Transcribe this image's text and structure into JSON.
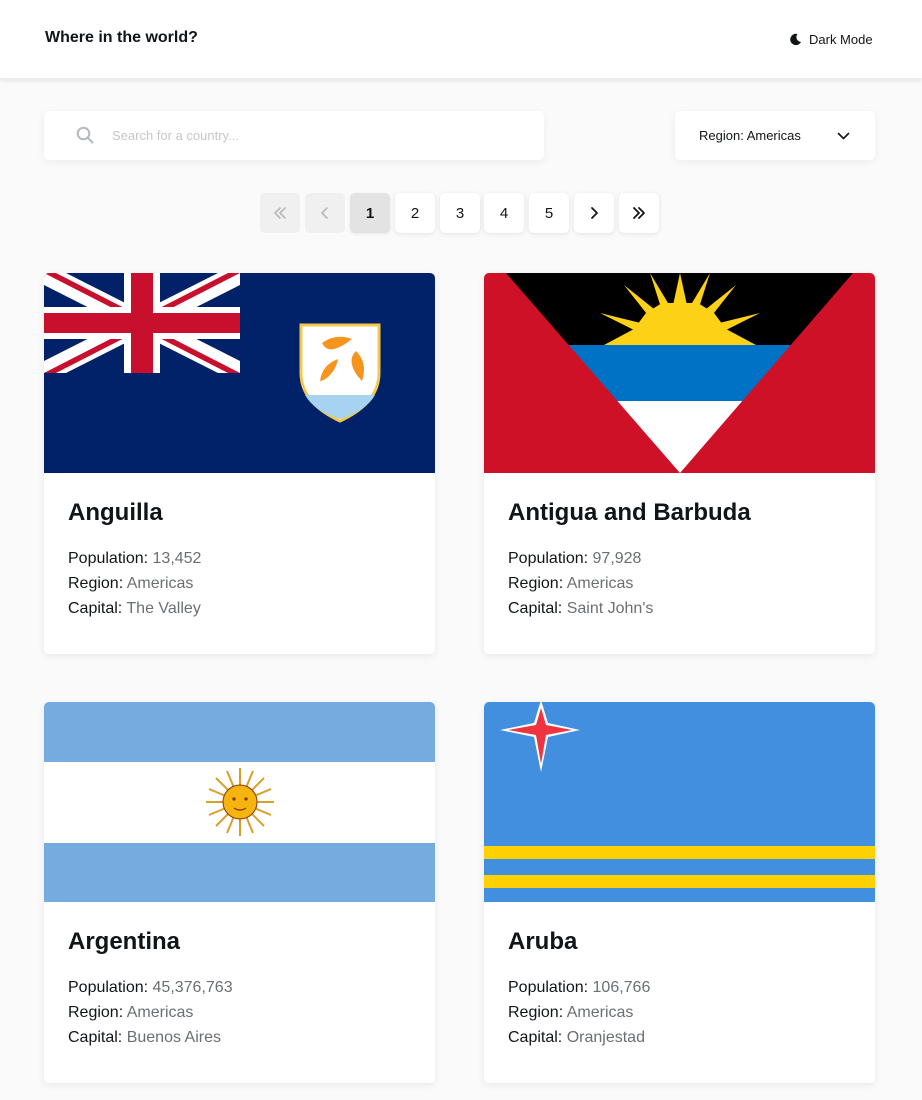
{
  "header": {
    "title": "Where in the world?",
    "dark_mode_label": "Dark Mode"
  },
  "search": {
    "placeholder": "Search for a country...",
    "value": ""
  },
  "filter": {
    "label": "Region: Americas"
  },
  "pagination": {
    "pages": [
      "1",
      "2",
      "3",
      "4",
      "5"
    ],
    "current_page": "1"
  },
  "fact_labels": {
    "population": "Population:",
    "region": "Region:",
    "capital": "Capital:"
  },
  "countries": [
    {
      "name": "Anguilla",
      "population": "13,452",
      "region": "Americas",
      "capital": "The Valley",
      "flag_icon": "anguilla-flag"
    },
    {
      "name": "Antigua and Barbuda",
      "population": "97,928",
      "region": "Americas",
      "capital": "Saint John's",
      "flag_icon": "antigua-and-barbuda-flag"
    },
    {
      "name": "Argentina",
      "population": "45,376,763",
      "region": "Americas",
      "capital": "Buenos Aires",
      "flag_icon": "argentina-flag"
    },
    {
      "name": "Aruba",
      "population": "106,766",
      "region": "Americas",
      "capital": "Oranjestad",
      "flag_icon": "aruba-flag"
    }
  ],
  "colors": {
    "background": "#fafafa",
    "card": "#ffffff",
    "text": "#111517",
    "muted_text": "#6b6f72"
  }
}
